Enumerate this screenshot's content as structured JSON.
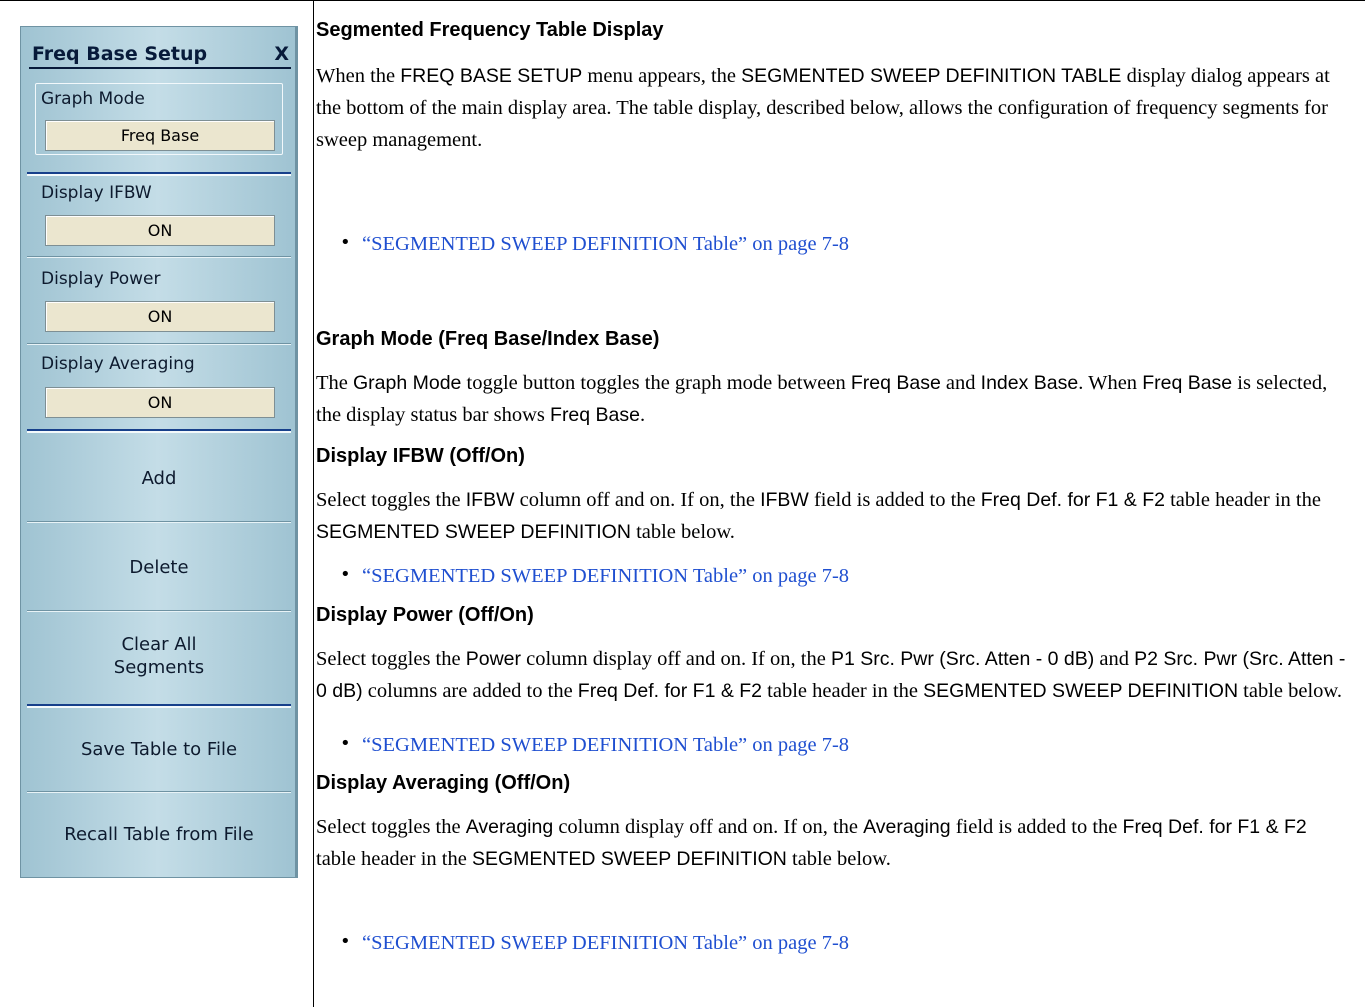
{
  "panel": {
    "title": "Freq Base Setup",
    "close": "X",
    "graph_mode": {
      "label": "Graph Mode",
      "value": "Freq Base"
    },
    "display_ifbw": {
      "label": "Display IFBW",
      "value": "ON"
    },
    "display_power": {
      "label": "Display Power",
      "value": "ON"
    },
    "display_averaging": {
      "label": "Display Averaging",
      "value": "ON"
    },
    "buttons": {
      "add": "Add",
      "delete": "Delete",
      "clear_all_line1": "Clear All",
      "clear_all_line2": "Segments",
      "save": "Save Table to File",
      "recall": "Recall Table from File"
    }
  },
  "doc": {
    "bullet": "•",
    "link_text": "“SEGMENTED SWEEP DEFINITION Table” on page 7-8",
    "s1": {
      "heading": "Segmented Frequency Table Display",
      "p1": "When the ",
      "p2": "FREQ BASE SETUP",
      "p3": " menu appears, the ",
      "p4": "SEGMENTED SWEEP DEFINITION TABLE",
      "p5": " display dialog appears at the bottom of the main display area. The table display, described below, allows the configuration of frequency segments for sweep management."
    },
    "s2": {
      "heading": "Graph Mode (Freq Base/Index Base)",
      "p1": "The ",
      "p2": "Graph Mode",
      "p3": " toggle button toggles the graph mode between ",
      "p4": "Freq Base",
      "p5": " and ",
      "p6": "Index Base",
      "p7": ". When ",
      "p8": "Freq Base",
      "p9": " is selected, the display status bar shows ",
      "p10": "Freq Base",
      "p11": "."
    },
    "s3": {
      "heading": "Display IFBW (Off/On)",
      "p1": "Select toggles the ",
      "p2": "IFBW",
      "p3": " column off and on. If on, the ",
      "p4": "IFBW",
      "p5": " field is added to the ",
      "p6": "Freq Def. for F1 & F2",
      "p7": " table header in the ",
      "p8": "SEGMENTED SWEEP DEFINITION",
      "p9": " table below."
    },
    "s4": {
      "heading": "Display Power (Off/On)",
      "p1": "Select toggles the ",
      "p2": "Power",
      "p3": " column display off and on. If on, the ",
      "p4": "P1 Src. Pwr (Src. Atten - 0 dB)",
      "p5": " and ",
      "p6": "P2 Src. Pwr (Src. Atten - 0 dB)",
      "p7": " columns are added to the ",
      "p8": "Freq Def. for F1 & F2",
      "p9": " table header in the ",
      "p10": "SEGMENTED SWEEP DEFINITION",
      "p11": " table below."
    },
    "s5": {
      "heading": "Display Averaging (Off/On)",
      "p1": "Select toggles the ",
      "p2": "Averaging",
      "p3": " column display off and on. If on, the ",
      "p4": "Averaging",
      "p5": " field is added to the ",
      "p6": "Freq Def. for F1 & F2",
      "p7": " table header in the ",
      "p8": "SEGMENTED SWEEP DEFINITION",
      "p9": " table below."
    }
  }
}
